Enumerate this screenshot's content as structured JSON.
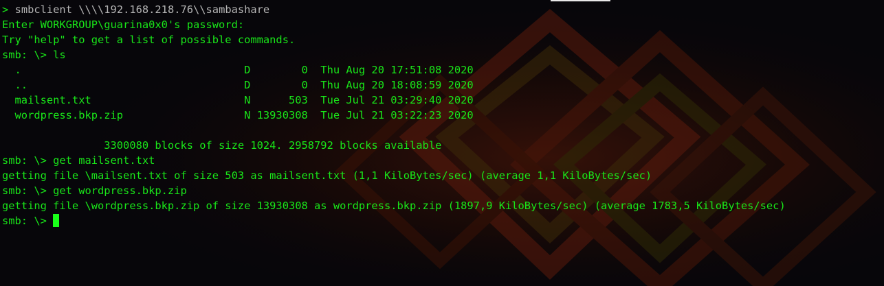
{
  "terminal": {
    "first_prompt_symbol": ">",
    "first_command": "smbclient \\\\\\\\192.168.218.76\\\\sambashare",
    "password_prompt": "Enter WORKGROUP\\guarina0x0's password:",
    "help_hint": "Try \"help\" to get a list of possible commands.",
    "cmd_ls": "smb: \\> ls",
    "listing": [
      "  .                                   D        0  Thu Aug 20 17:51:08 2020",
      "  ..                                  D        0  Thu Aug 20 18:08:59 2020",
      "  mailsent.txt                        N      503  Tue Jul 21 03:29:40 2020",
      "  wordpress.bkp.zip                   N 13930308  Tue Jul 21 03:22:23 2020"
    ],
    "blocks_info": "                3300080 blocks of size 1024. 2958792 blocks available",
    "cmd_get_mail": "smb: \\> get mailsent.txt",
    "get_mail_result": "getting file \\mailsent.txt of size 503 as mailsent.txt (1,1 KiloBytes/sec) (average 1,1 KiloBytes/sec)",
    "cmd_get_wp": "smb: \\> get wordpress.bkp.zip",
    "get_wp_result": "getting file \\wordpress.bkp.zip of size 13930308 as wordpress.bkp.zip (1897,9 KiloBytes/sec) (average 1783,5 KiloBytes/sec)",
    "final_prompt": "smb: \\> "
  },
  "colors": {
    "terminal_green": "#19e619",
    "command_grey": "#b5b5b5",
    "background": "#07060a",
    "cursor": "#19ff19"
  }
}
